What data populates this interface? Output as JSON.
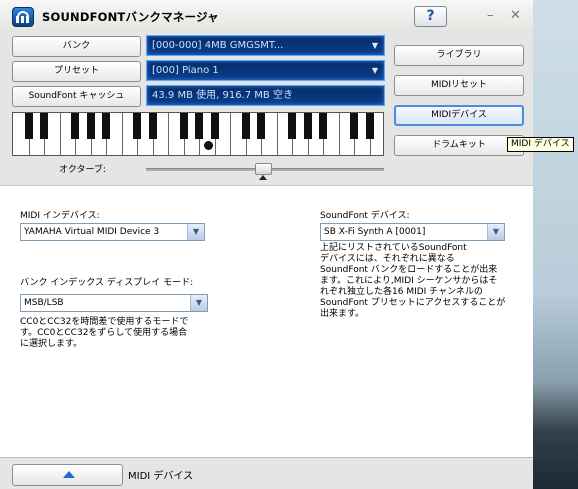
{
  "window": {
    "title": "SOUNDFONTバンクマネージャ",
    "help_label": "?",
    "minimize_glyph": "–",
    "close_glyph": "✕"
  },
  "left_buttons": {
    "bank": "バンク",
    "preset": "プリセット",
    "cache": "SoundFont キャッシュ"
  },
  "displays": {
    "bank": "[000-000] 4MB GMGSMT...",
    "preset": "[000] Piano 1",
    "memory": "43.9 MB 使用, 916.7 MB 空き"
  },
  "right_buttons": {
    "library": "ライブラリ",
    "midi_reset": "MIDIリセット",
    "midi_device": "MIDIデバイス",
    "drum_kit": "ドラムキット"
  },
  "keyboard": {
    "octave_label": "オクターブ:"
  },
  "tooltip": "MIDI デバイス",
  "content": {
    "midi_device_label": "MIDI インデバイス:",
    "midi_device_value": "YAMAHA Virtual MIDI Device 3",
    "bank_mode_label": "バンク インデックス ディスプレイ モード:",
    "bank_mode_value": "MSB/LSB",
    "bank_mode_desc": [
      "CC0とCC32を時間差で使用するモードで",
      "す。CC0とCC32をずらして使用する場合",
      "に選択します。"
    ],
    "sf_device_label": "SoundFont デバイス:",
    "sf_device_value": "SB X-Fi Synth A [0001]",
    "sf_device_desc": [
      "上記にリストされているSoundFont",
      "デバイスには、それぞれに異なる",
      "SoundFont バンクをロードすることが出来",
      "ます。これにより,MIDI シーケンサからはそ",
      "れぞれ独立した各16 MIDI チャンネルの",
      "SoundFont プリセットにアクセスすることが",
      "出来ます。"
    ]
  },
  "bottom": {
    "label": "MIDI デバイス"
  },
  "colors": {
    "lcd_bg": "#0a3f8c",
    "lcd_text": "#c7e2ff",
    "accent": "#1a6fd6"
  }
}
